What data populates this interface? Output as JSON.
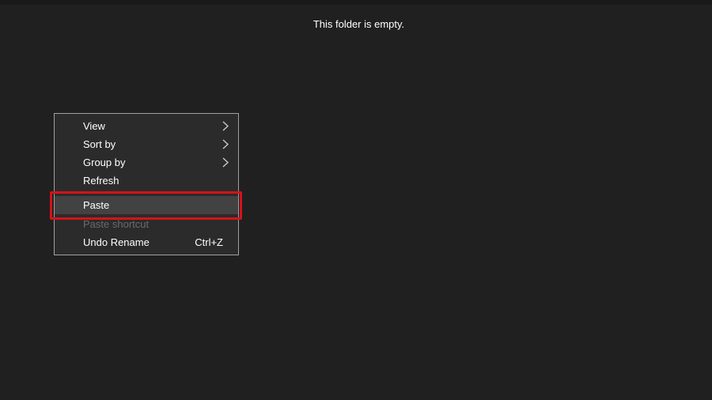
{
  "folder": {
    "empty_message": "This folder is empty."
  },
  "context_menu": {
    "items": [
      {
        "label": "View",
        "has_submenu": true,
        "enabled": true
      },
      {
        "label": "Sort by",
        "has_submenu": true,
        "enabled": true
      },
      {
        "label": "Group by",
        "has_submenu": true,
        "enabled": true
      },
      {
        "label": "Refresh",
        "has_submenu": false,
        "enabled": true
      },
      {
        "label": "Paste",
        "has_submenu": false,
        "enabled": true,
        "highlighted": true
      },
      {
        "label": "Paste shortcut",
        "has_submenu": false,
        "enabled": false
      },
      {
        "label": "Undo Rename",
        "shortcut": "Ctrl+Z",
        "has_submenu": false,
        "enabled": true
      }
    ]
  },
  "colors": {
    "background": "#202020",
    "menu_background": "#2b2b2b",
    "menu_border": "#a0a0a0",
    "highlight_ring": "#d4121a",
    "disabled_text": "#6a6a6a"
  },
  "icons": {
    "submenu_indicator": "chevron-right-icon"
  }
}
